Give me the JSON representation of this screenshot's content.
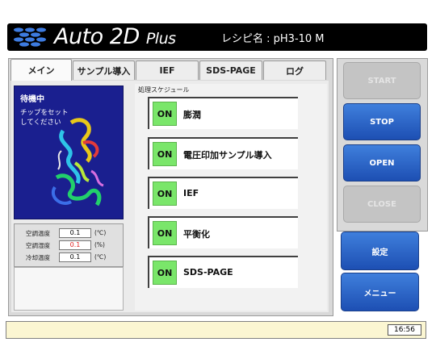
{
  "header": {
    "title_main": "Auto 2D",
    "title_sub": "Plus",
    "recipe_label": "レシピ名 : pH3-10 M"
  },
  "tabs": [
    {
      "label": "メイン",
      "active": true
    },
    {
      "label": "サンプル導入",
      "active": false
    },
    {
      "label": "IEF",
      "active": false
    },
    {
      "label": "SDS-PAGE",
      "active": false
    },
    {
      "label": "ログ",
      "active": false
    }
  ],
  "status": {
    "title": "待機中",
    "message_line1": "チップをセット",
    "message_line2": "してください"
  },
  "readings": [
    {
      "label": "空調温度",
      "value": "0.1",
      "unit": "(℃)",
      "value_color": "#111111"
    },
    {
      "label": "空調湿度",
      "value": "0.1",
      "unit": "(%)",
      "value_color": "#e02020"
    },
    {
      "label": "冷却温度",
      "value": "0.1",
      "unit": "(℃)",
      "value_color": "#111111"
    }
  ],
  "schedule": {
    "label": "処理スケジュール",
    "steps": [
      {
        "state": "ON",
        "label": "膨潤"
      },
      {
        "state": "ON",
        "label": "電圧印加サンプル導入"
      },
      {
        "state": "ON",
        "label": "IEF"
      },
      {
        "state": "ON",
        "label": "平衡化"
      },
      {
        "state": "ON",
        "label": "SDS-PAGE"
      }
    ]
  },
  "controls": {
    "start": "START",
    "stop": "STOP",
    "open": "OPEN",
    "close": "CLOSE",
    "settings": "設定",
    "menu": "メニュー"
  },
  "statusbar": {
    "time": "16:56"
  },
  "colors": {
    "accent_blue": "#2b62c8",
    "on_green": "#7ae66a",
    "status_panel": "#1a1f8f",
    "statusbar_bg": "#fbf6d2"
  }
}
